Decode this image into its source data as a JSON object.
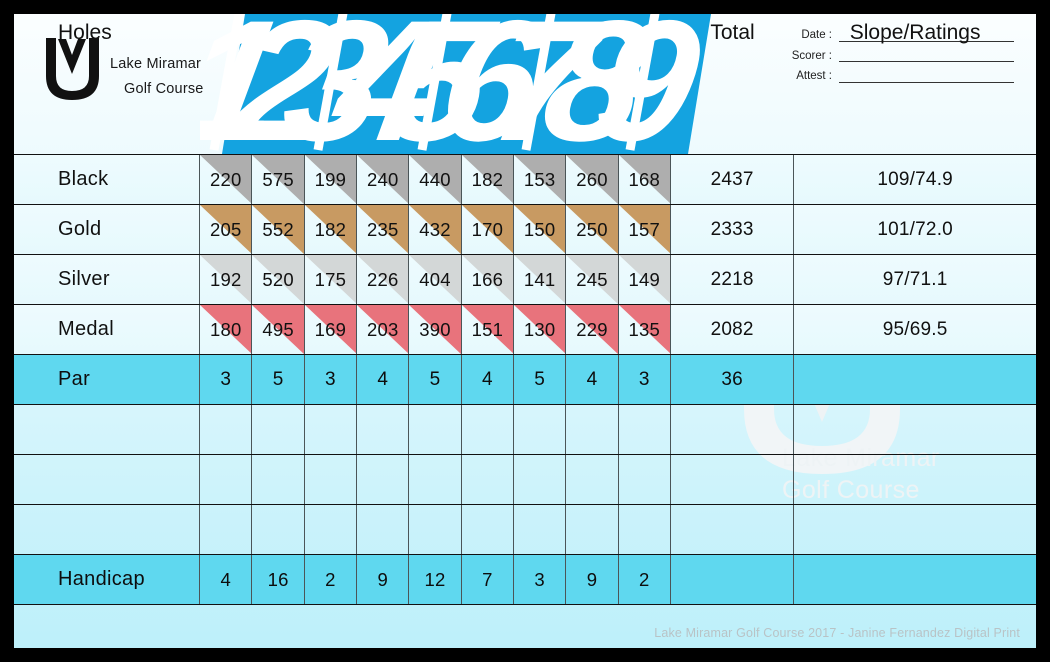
{
  "brand": {
    "logo_icon": "m-monogram-logo",
    "name_line1": "Lake Miramar",
    "name_line2": "Golf Course"
  },
  "form_fields": [
    {
      "label": "Date :"
    },
    {
      "label": "Scorer :"
    },
    {
      "label": "Attest :"
    }
  ],
  "holes_banner": {
    "numbers": [
      "1",
      "2",
      "3",
      "4",
      "5",
      "6",
      "7",
      "8",
      "9"
    ],
    "band_color": "#14A3E0"
  },
  "headers": {
    "holes": "Holes",
    "total": "Total",
    "slope": "Slope/Ratings"
  },
  "tee_rows": [
    {
      "name": "Black",
      "color": "#AEAEAE",
      "yards": [
        "220",
        "575",
        "199",
        "240",
        "440",
        "182",
        "153",
        "260",
        "168"
      ],
      "total": "2437",
      "slope": "109/74.9"
    },
    {
      "name": "Gold",
      "color": "#C89A62",
      "yards": [
        "205",
        "552",
        "182",
        "235",
        "432",
        "170",
        "150",
        "250",
        "157"
      ],
      "total": "2333",
      "slope": "101/72.0"
    },
    {
      "name": "Silver",
      "color": "#D3D7D7",
      "yards": [
        "192",
        "520",
        "175",
        "226",
        "404",
        "166",
        "141",
        "245",
        "149"
      ],
      "total": "2218",
      "slope": "97/71.1"
    },
    {
      "name": "Medal",
      "color": "#E8737C",
      "yards": [
        "180",
        "495",
        "169",
        "203",
        "390",
        "151",
        "130",
        "229",
        "135"
      ],
      "total": "2082",
      "slope": "95/69.5"
    }
  ],
  "par_row": {
    "name": "Par",
    "values": [
      "3",
      "5",
      "3",
      "4",
      "5",
      "4",
      "5",
      "4",
      "3"
    ],
    "total": "36",
    "slope": ""
  },
  "blank_rows": [
    {
      "name": "",
      "values": [
        "",
        "",
        "",
        "",
        "",
        "",
        "",
        "",
        ""
      ],
      "total": "",
      "slope": ""
    },
    {
      "name": "",
      "values": [
        "",
        "",
        "",
        "",
        "",
        "",
        "",
        "",
        ""
      ],
      "total": "",
      "slope": ""
    },
    {
      "name": "",
      "values": [
        "",
        "",
        "",
        "",
        "",
        "",
        "",
        "",
        ""
      ],
      "total": "",
      "slope": ""
    }
  ],
  "handicap_row": {
    "name": "Handicap",
    "values": [
      "4",
      "16",
      "2",
      "9",
      "12",
      "7",
      "3",
      "9",
      "2"
    ],
    "total": "",
    "slope": ""
  },
  "watermark": {
    "line1": "Lake Miramar",
    "line2": "Golf Course"
  },
  "credit": "Lake Miramar Golf Course 2017 - Janine Fernandez Digital Print",
  "palette": {
    "accent_cyan": "#14A3E0",
    "row_highlight": "#5FD8EF",
    "card_bg_top": "#FBFEFF",
    "card_bg_bottom": "#BDF0FA",
    "frame": "#000000"
  }
}
